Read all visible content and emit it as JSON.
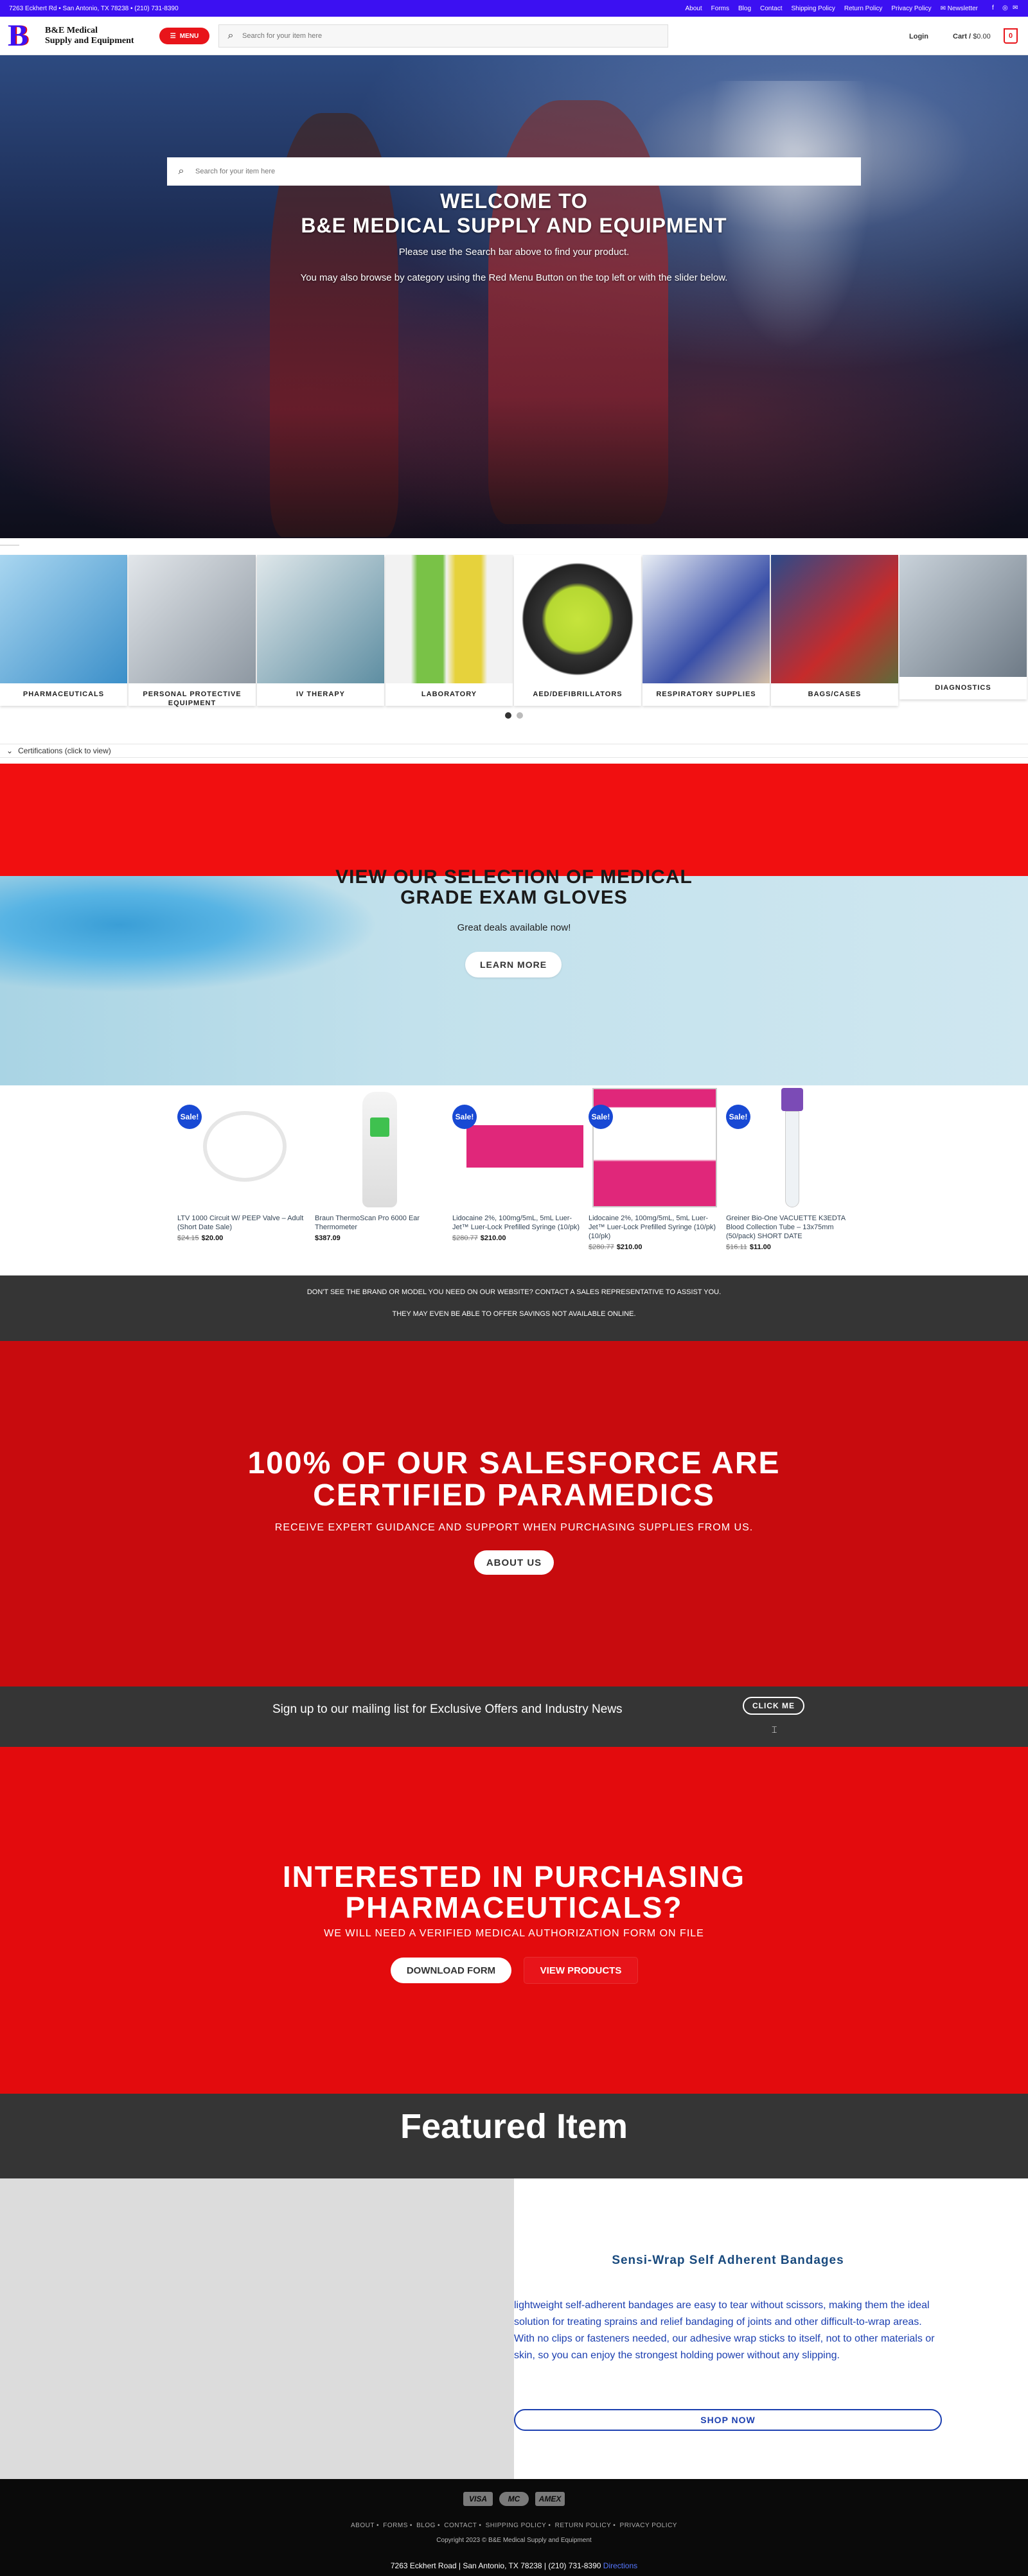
{
  "topbar": {
    "address": "7263 Eckhert Rd • San Antonio, TX 78238 • (210) 731-8390",
    "links": [
      "About",
      "Forms",
      "Blog",
      "Contact",
      "Shipping Policy",
      "Return Policy",
      "Privacy Policy"
    ],
    "newsletter": "Newsletter"
  },
  "header": {
    "logo_line1": "B&E Medical",
    "logo_line2": "Supply and Equipment",
    "menu_label": "MENU",
    "search_placeholder": "Search for your item here",
    "login": "Login",
    "cart_label": "Cart /",
    "cart_amount": "$0.00",
    "cart_count": "0"
  },
  "hero": {
    "search_placeholder": "Search for your item here",
    "title_line1": "WELCOME TO",
    "title_line2": "B&E MEDICAL SUPPLY AND EQUIPMENT",
    "sub1": "Please use the Search bar above to find your product.",
    "sub2": "You may also browse by category using the Red Menu Button on the top left or with the slider below."
  },
  "categories": [
    {
      "label": "PHARMACEUTICALS",
      "color": "#5aa6d6"
    },
    {
      "label": "PERSONAL PROTECTIVE EQUIPMENT",
      "color": "#b9c3cc"
    },
    {
      "label": "IV THERAPY",
      "color": "#7fa6b4"
    },
    {
      "label": "LABORATORY",
      "color": "#c8d94a"
    },
    {
      "label": "AED/DEFIBRILLATORS",
      "color": "#c7e24a"
    },
    {
      "label": "RESPIRATORY SUPPLIES",
      "color": "#5b6fb8"
    },
    {
      "label": "BAGS/CASES",
      "color": "#d23b3b"
    },
    {
      "label": "DIAGNOSTICS",
      "color": "#9aa5b0"
    }
  ],
  "certifications": "Certifications (click to view)",
  "gloves": {
    "title_line1": "VIEW OUR SELECTION OF MEDICAL",
    "title_line2": "GRADE EXAM GLOVES",
    "sub": "Great deals available now!",
    "button": "LEARN MORE"
  },
  "products": [
    {
      "name": "LTV 1000 Circuit W/ PEEP Valve – Adult (Short Date Sale)",
      "old_price": "$24.15",
      "price": "$20.00",
      "sale": "Sale!"
    },
    {
      "name": "Braun ThermoScan Pro 6000 Ear Thermometer",
      "old_price": "",
      "price": "$387.09",
      "sale": ""
    },
    {
      "name": "Lidocaine 2%, 100mg/5mL, 5mL Luer-Jet™ Luer-Lock Prefilled Syringe (10/pk)",
      "old_price": "$280.77",
      "price": "$210.00",
      "sale": "Sale!"
    },
    {
      "name": "Lidocaine 2%, 100mg/5mL, 5mL Luer-Jet™ Luer-Lock Prefilled Syringe (10/pk) (10/pk)",
      "old_price": "$280.77",
      "price": "$210.00",
      "sale": "Sale!"
    },
    {
      "name": "Greiner Bio-One VACUETTE K3EDTA Blood Collection Tube – 13x75mm (50/pack) SHORT DATE",
      "old_price": "$16.11",
      "price": "$11.00",
      "sale": "Sale!"
    }
  ],
  "info": {
    "line1": "DON'T SEE THE BRAND OR MODEL YOU NEED ON OUR WEBSITE? CONTACT A SALES REPRESENTATIVE TO ASSIST YOU.",
    "line2": "THEY MAY EVEN BE ABLE TO OFFER SAVINGS NOT AVAILABLE ONLINE."
  },
  "salesforce": {
    "title_line1": "100% OF OUR SALESFORCE ARE",
    "title_line2": "CERTIFIED PARAMEDICS",
    "sub": "RECEIVE EXPERT GUIDANCE AND SUPPORT WHEN PURCHASING SUPPLIES FROM US.",
    "button": "ABOUT US"
  },
  "mailing": {
    "text": "Sign up to our mailing list for Exclusive Offers and Industry News",
    "button": "CLICK ME"
  },
  "pharma": {
    "title_line1": "INTERESTED IN PURCHASING",
    "title_line2": "PHARMACEUTICALS?",
    "sub": "WE WILL NEED A VERIFIED MEDICAL AUTHORIZATION FORM ON FILE",
    "btn_download": "DOWNLOAD FORM",
    "btn_products": "VIEW PRODUCTS"
  },
  "featured": {
    "heading": "Featured Item",
    "name": "Sensi-Wrap Self Adherent Bandages",
    "description": "lightweight self-adherent bandages are easy to tear without scissors, making them the ideal solution for treating sprains and relief bandaging of joints and other difficult-to-wrap areas. With no clips or fasteners needed, our adhesive wrap sticks to itself, not to other materials or skin, so you can enjoy the strongest holding power without any slipping.",
    "button": "SHOP NOW"
  },
  "footer": {
    "payments": [
      "VISA",
      "MC",
      "AMEX"
    ],
    "links": [
      "ABOUT",
      "FORMS",
      "BLOG",
      "CONTACT",
      "SHIPPING POLICY",
      "RETURN POLICY",
      "PRIVACY POLICY"
    ],
    "copyright": "Copyright 2023 © B&E Medical Supply and Equipment",
    "address": "7263 Eckhert Road | San Antonio, TX 78238 | (210) 731-8390",
    "directions": "Directions"
  }
}
